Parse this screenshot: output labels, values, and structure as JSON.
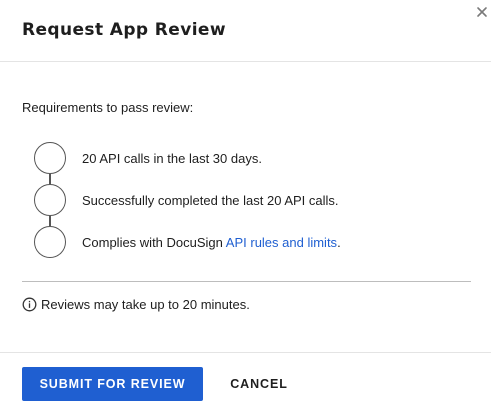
{
  "dialog": {
    "title": "Request App Review",
    "close_icon": "close-icon"
  },
  "requirements": {
    "intro": "Requirements to pass review:",
    "items": [
      {
        "text": "20 API calls in the last 30 days."
      },
      {
        "text": "Successfully completed the last 20 API calls."
      },
      {
        "text": "Complies with DocuSign ",
        "link": "API rules and limits",
        "suffix": "."
      }
    ]
  },
  "note": {
    "icon": "info-icon",
    "text": "Reviews may take up to 20 minutes."
  },
  "footer": {
    "submit_label": "SUBMIT FOR REVIEW",
    "cancel_label": "CANCEL"
  },
  "colors": {
    "primary": "#1f5fd1",
    "link": "#1f5fd1",
    "text": "#1e1e1e",
    "border": "#e4e4e4"
  }
}
